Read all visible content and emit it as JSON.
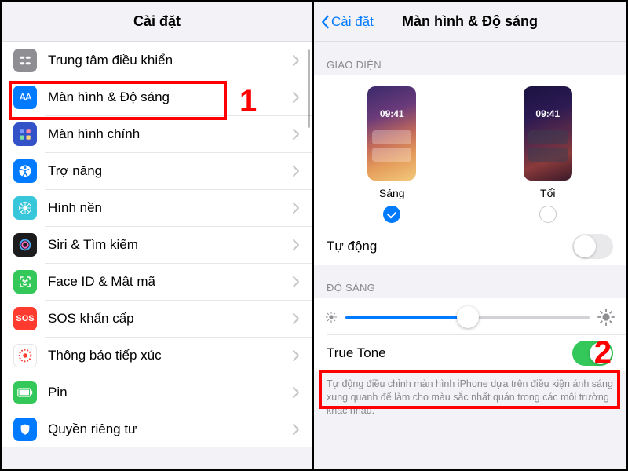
{
  "left": {
    "title": "Cài đặt",
    "items": [
      {
        "label": "Trung tâm điều khiển",
        "icon": "control-center",
        "bg": "#8e8e93"
      },
      {
        "label": "Màn hình & Độ sáng",
        "icon": "display",
        "bg": "#007aff"
      },
      {
        "label": "Màn hình chính",
        "icon": "home",
        "bg": "#3452c8"
      },
      {
        "label": "Trợ năng",
        "icon": "accessibility",
        "bg": "#007aff"
      },
      {
        "label": "Hình nền",
        "icon": "wallpaper",
        "bg": "#38c6da"
      },
      {
        "label": "Siri & Tìm kiếm",
        "icon": "siri",
        "bg": "#1c1c1e"
      },
      {
        "label": "Face ID & Mật mã",
        "icon": "faceid",
        "bg": "#34c759"
      },
      {
        "label": "SOS khẩn cấp",
        "icon": "sos",
        "bg": "#ff3b30"
      },
      {
        "label": "Thông báo tiếp xúc",
        "icon": "exposure",
        "bg": "#ffffff"
      },
      {
        "label": "Pin",
        "icon": "battery",
        "bg": "#34c759"
      },
      {
        "label": "Quyền riêng tư",
        "icon": "privacy",
        "bg": "#007aff"
      }
    ]
  },
  "right": {
    "back": "Cài đặt",
    "title": "Màn hình & Độ sáng",
    "appearance_header": "GIAO DIỆN",
    "light_label": "Sáng",
    "dark_label": "Tối",
    "clock": "09:41",
    "auto_label": "Tự động",
    "brightness_header": "ĐỘ SÁNG",
    "brightness_percent": 50,
    "truetone_label": "True Tone",
    "truetone_note": "Tự động điều chỉnh màn hình iPhone dựa trên điều kiện ánh sáng xung quanh để làm cho màu sắc nhất quán trong các môi trường khác nhau."
  },
  "annotations": {
    "one": "1",
    "two": "2"
  }
}
